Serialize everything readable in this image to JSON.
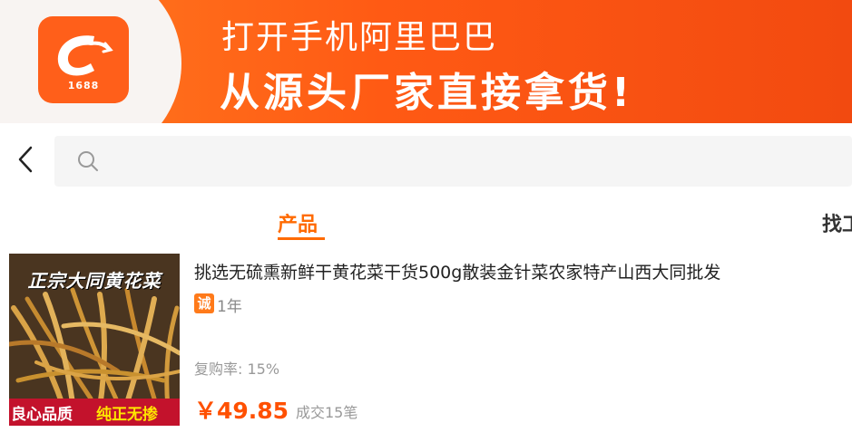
{
  "banner": {
    "logo_text": "1688",
    "line1": "打开手机阿里巴巴",
    "line2": "从源头厂家直接拿货!"
  },
  "search": {
    "value": "",
    "placeholder": ""
  },
  "tabs": {
    "product": "产品",
    "factory": "找工"
  },
  "product": {
    "image_title": "正宗大同黄花菜",
    "image_bar_left": "良心品质",
    "image_bar_right": "纯正无掺",
    "title": "挑选无硫熏新鲜干黄花菜干货500g散装金针菜农家特产山西大同批发",
    "badge": "诚",
    "years": "1年",
    "repurchase": "复购率: 15%",
    "price": "￥49.85",
    "sold": "成交15笔"
  },
  "colors": {
    "accent": "#ff6a00",
    "price": "#ff5000",
    "banner": "#ff5a14"
  }
}
